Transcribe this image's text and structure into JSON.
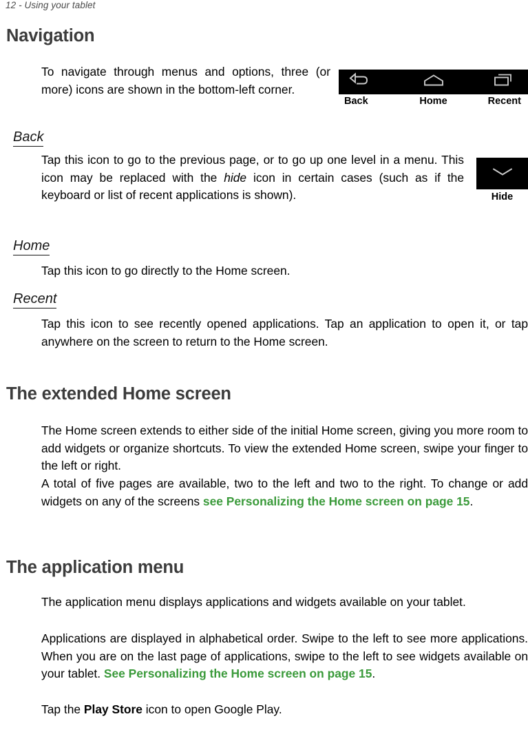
{
  "header": {
    "running_header": "12 - Using your tablet"
  },
  "sections": {
    "navigation": {
      "title": "Navigation",
      "intro": "To navigate through menus and options, three (or more) icons are shown in the bottom-left corner."
    },
    "back": {
      "title": "Back",
      "text_part1": "Tap this icon to go to the previous page, or to go up one level in a menu. This icon may be replaced with the ",
      "emphasis": "hide",
      "text_part2": " icon in certain cases (such as if the keyboard or list of recent applications is shown)."
    },
    "home": {
      "title": "Home",
      "text": "Tap this icon to go directly to the Home screen."
    },
    "recent": {
      "title": "Recent",
      "text": "Tap this icon to see recently opened applications. Tap an application to open it, or tap anywhere on the screen to return to the Home screen."
    },
    "extended_home": {
      "title": "The extended Home screen",
      "para1": "The Home screen extends to either side of the initial Home screen, giving you more room to add widgets or organize shortcuts. To view the extended Home screen, swipe your finger to the left or right.",
      "para2_part1": "A total of five pages are available, two to the left and two to the right. To change or add widgets on any of the screens ",
      "para2_xref": "see Personalizing the Home screen on page 15",
      "para2_part2": "."
    },
    "application_menu": {
      "title": "The application menu",
      "para1": "The application menu displays applications and widgets available on your tablet.",
      "para2_part1": "Applications are displayed in alphabetical order. Swipe to the left to see more applications. When you are on the last page of applications, swipe to the left to see widgets available on your tablet. ",
      "para2_xref": "See Personalizing the Home screen on page 15",
      "para2_part2": ".",
      "para3_part1": "Tap the ",
      "para3_bold": "Play Store",
      "para3_part2": " icon to open Google Play."
    }
  },
  "figures": {
    "navbar": {
      "icons": [
        "back-arrow-icon",
        "home-icon",
        "recent-apps-icon"
      ],
      "labels": {
        "back": "Back",
        "home": "Home",
        "recent": "Recent"
      },
      "background_color": "#000000",
      "icon_color": "#c8c8c8"
    },
    "hide": {
      "icon": "chevron-down-icon",
      "label": "Hide",
      "background_color": "#000000",
      "icon_color": "#c8c8c8"
    }
  },
  "colors": {
    "xref_green": "#3a9a3a",
    "heading_gray": "#3c3c3c",
    "header_gray": "#4b4b4b"
  }
}
